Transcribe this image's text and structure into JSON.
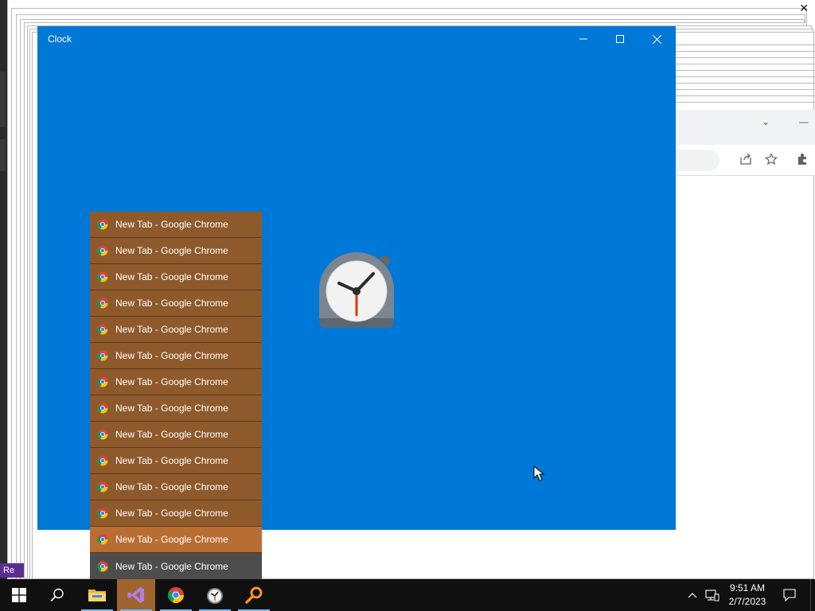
{
  "clock_window": {
    "title": "Clock",
    "minimize_label": "",
    "maximize_label": "",
    "close_label": ""
  },
  "window_list": {
    "items": [
      {
        "label": "New Tab - Google Chrome",
        "state": "normal"
      },
      {
        "label": "New Tab - Google Chrome",
        "state": "normal"
      },
      {
        "label": "New Tab - Google Chrome",
        "state": "normal"
      },
      {
        "label": "New Tab - Google Chrome",
        "state": "normal"
      },
      {
        "label": "New Tab - Google Chrome",
        "state": "normal"
      },
      {
        "label": "New Tab - Google Chrome",
        "state": "normal"
      },
      {
        "label": "New Tab - Google Chrome",
        "state": "normal"
      },
      {
        "label": "New Tab - Google Chrome",
        "state": "normal"
      },
      {
        "label": "New Tab - Google Chrome",
        "state": "normal"
      },
      {
        "label": "New Tab - Google Chrome",
        "state": "normal"
      },
      {
        "label": "New Tab - Google Chrome",
        "state": "normal"
      },
      {
        "label": "New Tab - Google Chrome",
        "state": "normal"
      },
      {
        "label": "New Tab - Google Chrome",
        "state": "hover"
      },
      {
        "label": "New Tab - Google Chrome",
        "state": "active"
      }
    ]
  },
  "background": {
    "badge_text": "Re"
  },
  "taskbar": {
    "apps": [
      {
        "name": "start-icon"
      },
      {
        "name": "search-icon"
      },
      {
        "name": "file-explorer-icon"
      },
      {
        "name": "visual-studio-icon"
      },
      {
        "name": "chrome-icon"
      },
      {
        "name": "clock-app-icon"
      },
      {
        "name": "magnifier-app-icon"
      }
    ],
    "time": "9:51 AM",
    "date": "2/7/2023"
  },
  "colors": {
    "clock_bg": "#0078d7",
    "list_item": "#8e5a2b",
    "list_item_hover": "#b86d33",
    "list_item_active": "#4d4d4d",
    "taskbar": "#101010"
  }
}
